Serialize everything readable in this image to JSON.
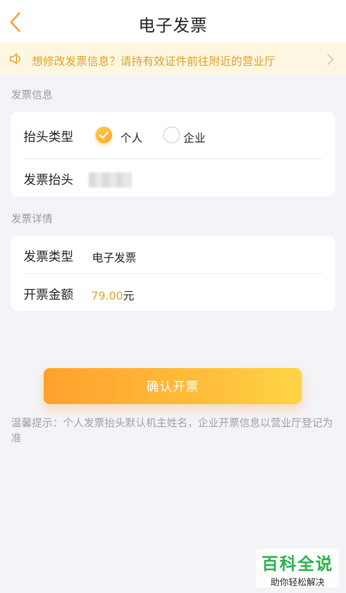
{
  "header": {
    "title": "电子发票"
  },
  "notice": {
    "text": "想修改发票信息？请持有效证件前往附近的营业厅"
  },
  "invoice_info": {
    "section_label": "发票信息",
    "type_label": "抬头类型",
    "options": [
      {
        "label": "个人",
        "checked": true
      },
      {
        "label": "企业",
        "checked": false
      }
    ],
    "title_label": "发票抬头"
  },
  "invoice_details": {
    "section_label": "发票详情",
    "type_label": "发票类型",
    "type_value": "电子发票",
    "amount_label": "开票金额",
    "amount_value": "79.00",
    "amount_unit": "元"
  },
  "confirm_button": {
    "label": "确认开票"
  },
  "tip": "温馨提示：个人发票抬头默认机主姓名，企业开票信息以营业厅登记为准",
  "watermark": {
    "title": "百科全说",
    "subtitle": "助你轻松解决"
  },
  "colors": {
    "accent": "#ffa726",
    "notice_text": "#e1a02a",
    "amount": "#e6a421"
  }
}
